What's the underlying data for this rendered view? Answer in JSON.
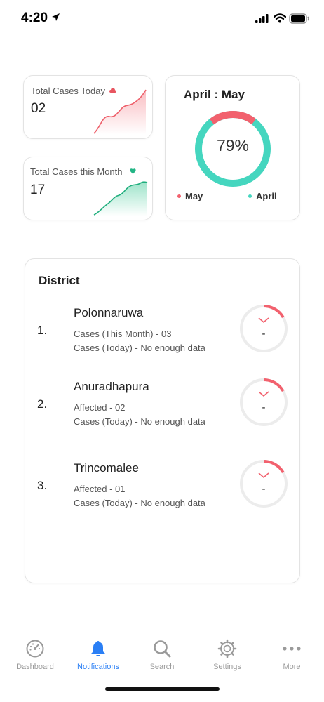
{
  "status_bar": {
    "time": "4:20",
    "icons": [
      "location-arrow-icon",
      "signal-icon",
      "wifi-icon",
      "battery-icon"
    ]
  },
  "stats": {
    "today": {
      "title": "Total Cases Today",
      "value": "02",
      "marker_icon": "red-cloud-icon",
      "color": "#f06870"
    },
    "month": {
      "title": "Total Cases this Month",
      "value": "17",
      "marker_icon": "green-heart-icon",
      "color": "#22b585"
    }
  },
  "ratio_card": {
    "title": "April : May",
    "percent_label": "79%",
    "percent": 79,
    "legend": [
      {
        "label": "May",
        "color": "#f2616e"
      },
      {
        "label": "April",
        "color": "#45d6bf"
      }
    ]
  },
  "district": {
    "heading": "District",
    "rows": [
      {
        "index": "1.",
        "name": "Polonnaruwa",
        "line1": "Cases (This Month) - 03",
        "line2": "Cases (Today) - No enough data",
        "gauge_value": "-",
        "trend_icon": "chevron-down-icon"
      },
      {
        "index": "2.",
        "name": "Anuradhapura",
        "line1": "Affected - 02",
        "line2": "Cases (Today) - No enough data",
        "gauge_value": "-",
        "trend_icon": "chevron-down-icon"
      },
      {
        "index": "3.",
        "name": "Trincomalee",
        "line1": "Affected - 01",
        "line2": "Cases (Today) - No enough data",
        "gauge_value": "-",
        "trend_icon": "chevron-down-icon"
      }
    ]
  },
  "tab_bar": {
    "active": "Notifications",
    "active_color": "#2a7ff5",
    "tabs": [
      {
        "label": "Dashboard",
        "icon": "dashboard-gauge-icon"
      },
      {
        "label": "Notifications",
        "icon": "bell-icon"
      },
      {
        "label": "Search",
        "icon": "search-icon"
      },
      {
        "label": "Settings",
        "icon": "gear-icon"
      },
      {
        "label": "More",
        "icon": "more-dots-icon"
      }
    ]
  }
}
